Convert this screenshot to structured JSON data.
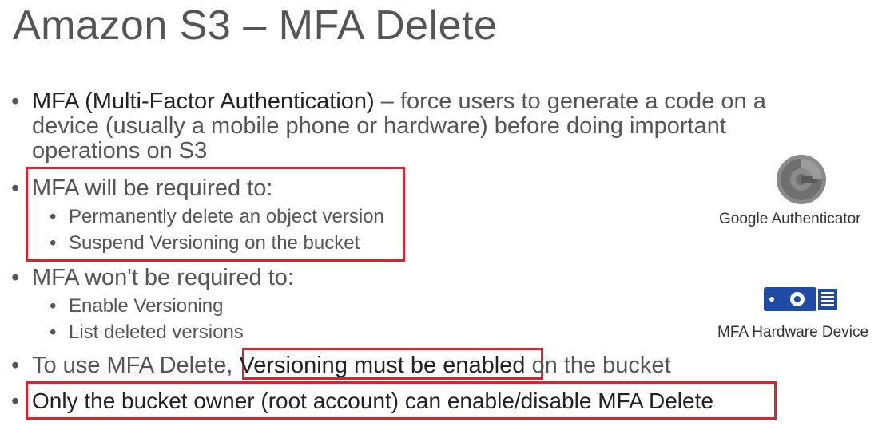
{
  "title": "Amazon S3 – MFA Delete",
  "bullets": {
    "b1_strong": "MFA (Multi-Factor Authentication)",
    "b1_rest": " – force users to generate a code on a",
    "b1_line2": "device (usually a mobile phone or hardware) before doing important",
    "b1_line3": "operations on S3",
    "b2": "MFA will be required to:",
    "b2_sub1": "Permanently delete an object version",
    "b2_sub2": "Suspend Versioning on the bucket",
    "b3": "MFA won't be required to:",
    "b3_sub1": "Enable Versioning",
    "b3_sub2": "List deleted versions",
    "b4_pre": "To use MFA Delete, ",
    "b4_strong": "Versioning must be enabled",
    "b4_post": " on the bucket",
    "b5": "Only the bucket owner (root account) can enable/disable MFA Delete",
    "dot": "•"
  },
  "side": {
    "google_label": "Google Authenticator",
    "hardware_label": "MFA Hardware Device"
  },
  "colors": {
    "highlight_box": "#d9232e",
    "google_icon": "#7a7a7a",
    "hardware_icon": "#1f4ba5"
  }
}
